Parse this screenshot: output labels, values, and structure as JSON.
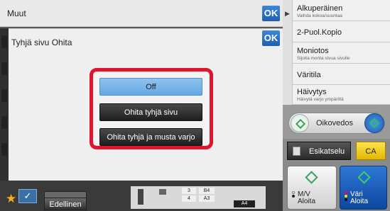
{
  "header": {
    "title": "Muut",
    "ok_label": "OK"
  },
  "dialog": {
    "title": "Tyhjä sivu Ohita",
    "ok_label": "OK",
    "options": [
      {
        "label": "Off",
        "selected": true
      },
      {
        "label": "Ohita tyhjä sivu",
        "selected": false
      },
      {
        "label": "Ohita tyhjä ja musta varjo",
        "selected": false
      }
    ]
  },
  "bottom": {
    "previous_label": "Edellinen",
    "trays": {
      "t3": "3",
      "t4": "4",
      "b4": "B4",
      "a3": "A3",
      "a4": "A4"
    }
  },
  "menu": {
    "items": [
      {
        "label": "Alkuperäinen",
        "sub": "Vaihda kokoa/suuntaa"
      },
      {
        "label": "2-Puol.Kopio",
        "sub": ""
      },
      {
        "label": "Moniotos",
        "sub": "Sijoita monta sivua sivulle"
      },
      {
        "label": "Väritila",
        "sub": ""
      },
      {
        "label": "Häivytys",
        "sub": "Häivytä varjo ympäriltä"
      }
    ]
  },
  "actions": {
    "oikovedos": "Oikovedos",
    "esikatselu": "Esikatselu",
    "ca": "CA",
    "start_mono_l1": "M/V",
    "start_mono_l2": "Aloita",
    "start_color_l1": "Väri",
    "start_color_l2": "Aloita"
  },
  "colors": {
    "accent_blue": "#1f5fb0",
    "highlight_red": "#e0142c",
    "ca_yellow": "#f0c800"
  }
}
